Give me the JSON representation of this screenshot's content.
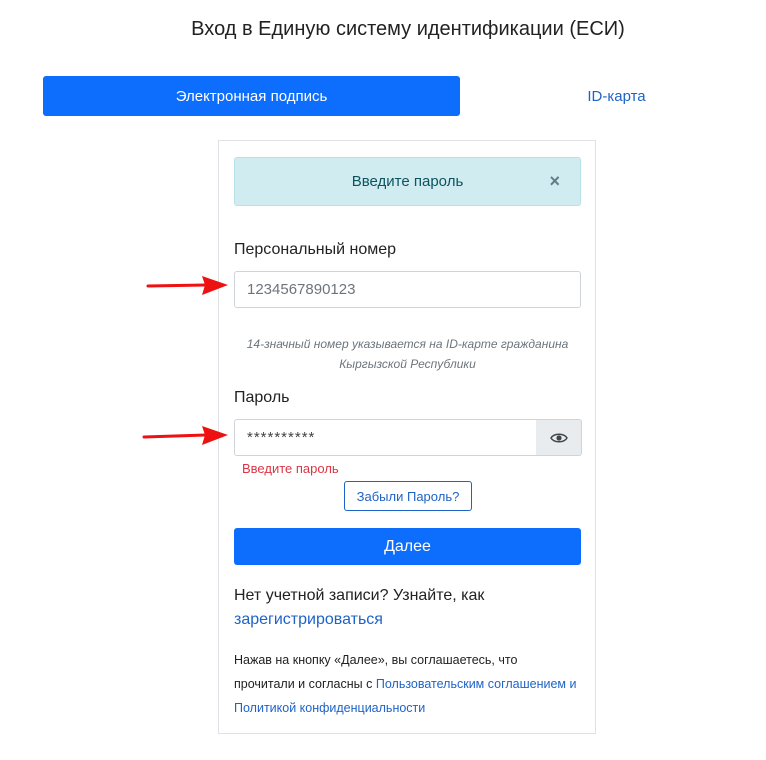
{
  "page_title": "Вход в Единую систему идентификации (ЕСИ)",
  "tabs": [
    {
      "label": "Электронная подпись",
      "active": true
    },
    {
      "label": "ID-карта",
      "active": false
    }
  ],
  "alert": {
    "message": "Введите пароль",
    "close_icon": "×"
  },
  "personal_number": {
    "label": "Персональный номер",
    "placeholder": "1234567890123",
    "hint": "14-значный номер указывается на ID-карте гражданина Кыргызской Республики"
  },
  "password": {
    "label": "Пароль",
    "value": "**********",
    "toggle_icon": "eye-icon",
    "error": "Введите пароль"
  },
  "forgot_password_label": "Забыли Пароль?",
  "submit_label": "Далее",
  "register": {
    "prefix": "Нет учетной записи? Узнайте, как",
    "link": "зарегистрироваться"
  },
  "agreement": {
    "text": "Нажав на кнопку «Далее», вы соглашаетесь, что прочитали и согласны с",
    "link": "Пользовательским соглашением и Политикой конфиденциальности"
  },
  "colors": {
    "primary": "#0d6efd",
    "link": "#1e63c8",
    "alert_bg": "#d1ecf1",
    "error": "#dc3545",
    "annotation_arrow": "#ee1111"
  }
}
